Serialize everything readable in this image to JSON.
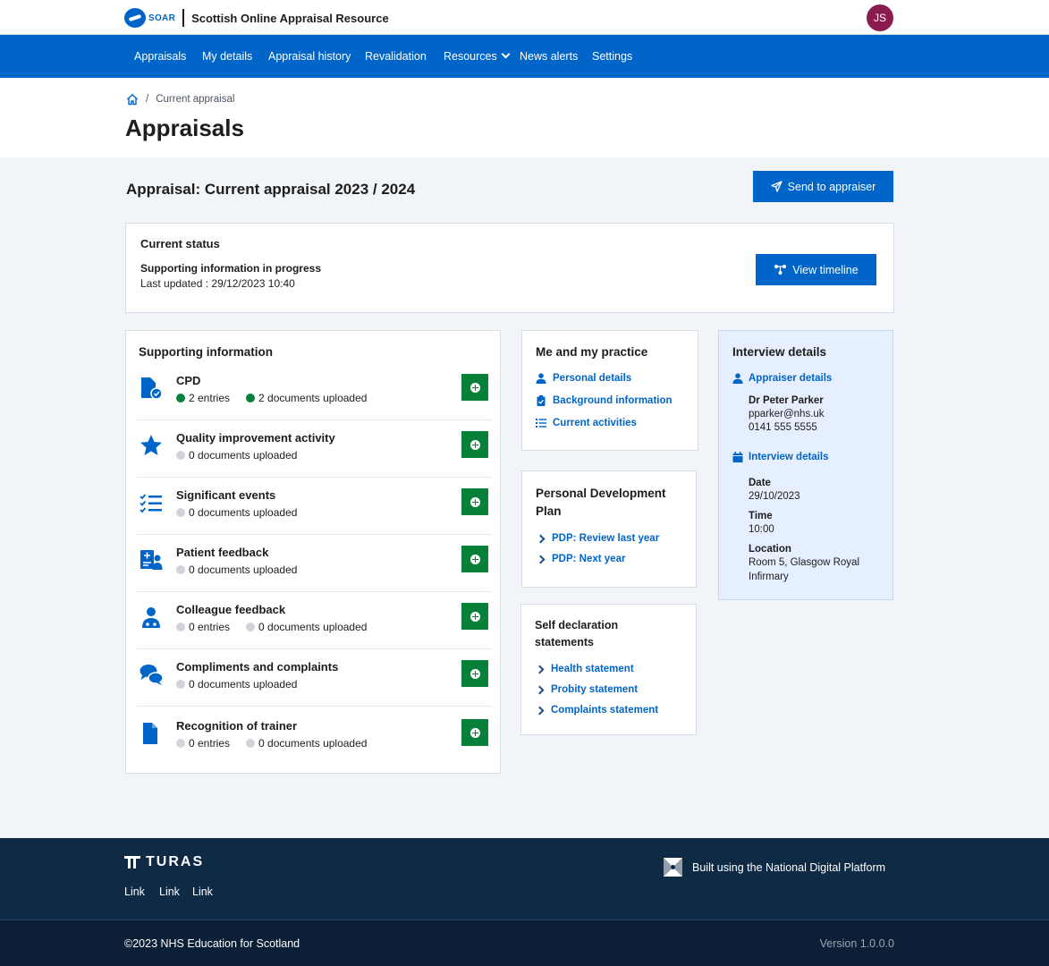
{
  "header": {
    "logo_text": "SOAR",
    "app_name": "Scottish Online Appraisal Resource",
    "avatar_initials": "JS"
  },
  "nav": {
    "items": [
      {
        "label": "Appraisals"
      },
      {
        "label": "My details"
      },
      {
        "label": "Appraisal history"
      },
      {
        "label": "Revalidation"
      },
      {
        "label": "Resources"
      },
      {
        "label": "News alerts"
      },
      {
        "label": "Settings"
      }
    ]
  },
  "breadcrumb": {
    "separator": "/",
    "current": "Current appraisal"
  },
  "page": {
    "title": "Appraisals",
    "appraisal_heading": "Appraisal: Current appraisal 2023 / 2024",
    "send_button": "Send to appraiser"
  },
  "status": {
    "title": "Current status",
    "state": "Supporting information in progress",
    "last_updated": "Last updated : 29/12/2023 10:40",
    "timeline_button": "View timeline"
  },
  "supporting_information": {
    "title": "Supporting information",
    "items": [
      {
        "title": "CPD",
        "icon": "document-check-icon",
        "entries": "2 entries",
        "documents": "2 documents uploaded",
        "status": "complete"
      },
      {
        "title": "Quality improvement activity",
        "icon": "star-icon",
        "documents": "0 documents uploaded",
        "status": "empty"
      },
      {
        "title": "Significant events",
        "icon": "checklist-icon",
        "documents": "0 documents uploaded",
        "status": "empty"
      },
      {
        "title": "Patient feedback",
        "icon": "patient-feedback-icon",
        "documents": "0 documents uploaded",
        "status": "empty"
      },
      {
        "title": "Colleague feedback",
        "icon": "colleague-icon",
        "entries": "0 entries",
        "documents": "0 documents uploaded",
        "status": "empty"
      },
      {
        "title": "Compliments and complaints",
        "icon": "chat-bubbles-icon",
        "documents": "0 documents uploaded",
        "status": "empty"
      },
      {
        "title": "Recognition of trainer",
        "icon": "file-icon",
        "entries": "0 entries",
        "documents": "0 documents uploaded",
        "status": "empty"
      }
    ]
  },
  "me_and_practice": {
    "title": "Me and my practice",
    "links": [
      {
        "label": "Personal details",
        "icon": "person-icon"
      },
      {
        "label": "Background information",
        "icon": "clipboard-icon"
      },
      {
        "label": "Current activities",
        "icon": "list-icon"
      }
    ]
  },
  "pdp": {
    "title_line1": "Personal Development",
    "title_line2": "Plan",
    "links": [
      {
        "label": "PDP: Review last year"
      },
      {
        "label": "PDP: Next year"
      }
    ]
  },
  "self_declaration": {
    "title_line1": "Self declaration",
    "title_line2": "statements",
    "links": [
      {
        "label": "Health statement"
      },
      {
        "label": "Probity statement"
      },
      {
        "label": "Complaints statement"
      }
    ]
  },
  "interview": {
    "title": "Interview details",
    "appraiser_link": "Appraiser details",
    "appraiser_name": "Dr Peter Parker",
    "appraiser_email": "pparker@nhs.uk",
    "appraiser_phone": "0141 555 5555",
    "details_link": "Interview details",
    "date_label": "Date",
    "date_value": "29/10/2023",
    "time_label": "Time",
    "time_value": "10:00",
    "location_label": "Location",
    "location_line1": "Room 5, Glasgow Royal",
    "location_line2": "Infirmary"
  },
  "footer": {
    "brand": "TURAS",
    "links": [
      "Link",
      "Link",
      "Link"
    ],
    "platform_text": "Built using the National Digital Platform",
    "copyright": "©2023 NHS Education for Scotland",
    "version": "Version 1.0.0.0"
  },
  "colors": {
    "primary": "#0065c8",
    "success": "#07803a",
    "footer": "#0f2a45",
    "avatar": "#8b1c4f"
  }
}
